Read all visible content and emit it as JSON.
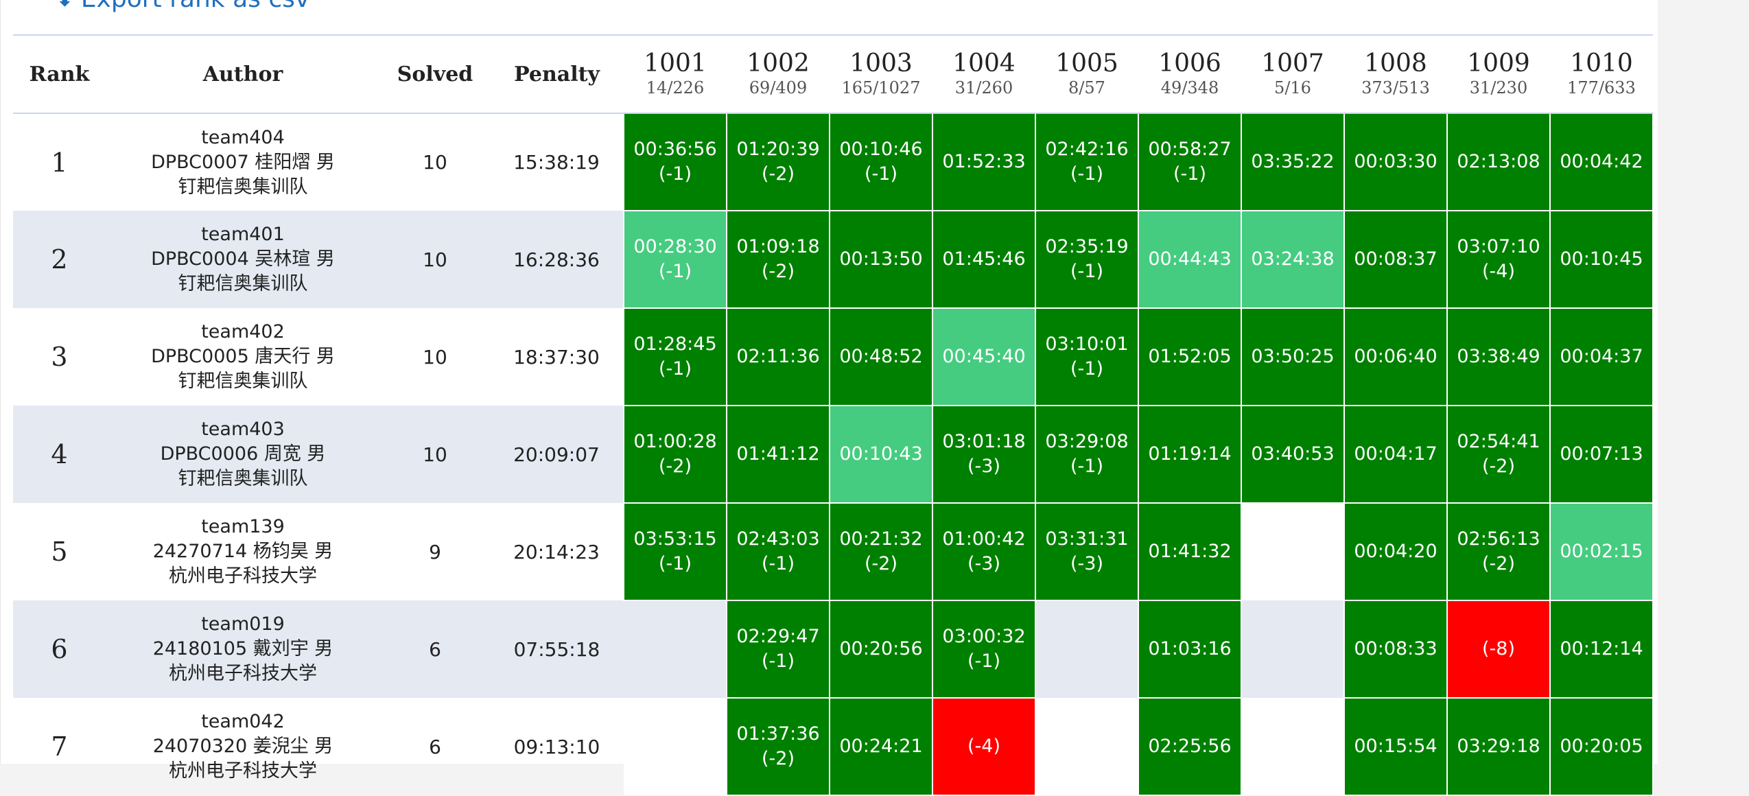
{
  "export": {
    "label": "Export rank as csv",
    "icon": "download-icon"
  },
  "headers": {
    "rank": "Rank",
    "author": "Author",
    "solved": "Solved",
    "penalty": "Penalty"
  },
  "problems": [
    {
      "id": "1001",
      "stat": "14/226"
    },
    {
      "id": "1002",
      "stat": "69/409"
    },
    {
      "id": "1003",
      "stat": "165/1027"
    },
    {
      "id": "1004",
      "stat": "31/260"
    },
    {
      "id": "1005",
      "stat": "8/57"
    },
    {
      "id": "1006",
      "stat": "49/348"
    },
    {
      "id": "1007",
      "stat": "5/16"
    },
    {
      "id": "1008",
      "stat": "373/513"
    },
    {
      "id": "1009",
      "stat": "31/230"
    },
    {
      "id": "1010",
      "stat": "177/633"
    }
  ],
  "colors": {
    "accepted": "#008000",
    "first_blood": "#45cc80",
    "wrong": "#ff0000",
    "alt_row": "#e4e9f2"
  },
  "rows": [
    {
      "rank": "1",
      "team": "team404",
      "member": "DPBC0007 桂阳熠 男",
      "org": "钉耙信奥集训队",
      "solved": "10",
      "penalty": "15:38:19",
      "cells": [
        {
          "s": "ac",
          "time": "00:36:56",
          "tries": "(-1)"
        },
        {
          "s": "ac",
          "time": "01:20:39",
          "tries": "(-2)"
        },
        {
          "s": "ac",
          "time": "00:10:46",
          "tries": "(-1)"
        },
        {
          "s": "ac",
          "time": "01:52:33",
          "tries": ""
        },
        {
          "s": "ac",
          "time": "02:42:16",
          "tries": "(-1)"
        },
        {
          "s": "ac",
          "time": "00:58:27",
          "tries": "(-1)"
        },
        {
          "s": "ac",
          "time": "03:35:22",
          "tries": ""
        },
        {
          "s": "ac",
          "time": "00:03:30",
          "tries": ""
        },
        {
          "s": "ac",
          "time": "02:13:08",
          "tries": ""
        },
        {
          "s": "ac",
          "time": "00:04:42",
          "tries": ""
        }
      ]
    },
    {
      "rank": "2",
      "team": "team401",
      "member": "DPBC0004 吴林瑄 男",
      "org": "钉耙信奥集训队",
      "solved": "10",
      "penalty": "16:28:36",
      "cells": [
        {
          "s": "fb",
          "time": "00:28:30",
          "tries": "(-1)"
        },
        {
          "s": "ac",
          "time": "01:09:18",
          "tries": "(-2)"
        },
        {
          "s": "ac",
          "time": "00:13:50",
          "tries": ""
        },
        {
          "s": "ac",
          "time": "01:45:46",
          "tries": ""
        },
        {
          "s": "ac",
          "time": "02:35:19",
          "tries": "(-1)"
        },
        {
          "s": "fb",
          "time": "00:44:43",
          "tries": ""
        },
        {
          "s": "fb",
          "time": "03:24:38",
          "tries": ""
        },
        {
          "s": "ac",
          "time": "00:08:37",
          "tries": ""
        },
        {
          "s": "ac",
          "time": "03:07:10",
          "tries": "(-4)"
        },
        {
          "s": "ac",
          "time": "00:10:45",
          "tries": ""
        }
      ]
    },
    {
      "rank": "3",
      "team": "team402",
      "member": "DPBC0005 唐天行 男",
      "org": "钉耙信奥集训队",
      "solved": "10",
      "penalty": "18:37:30",
      "cells": [
        {
          "s": "ac",
          "time": "01:28:45",
          "tries": "(-1)"
        },
        {
          "s": "ac",
          "time": "02:11:36",
          "tries": ""
        },
        {
          "s": "ac",
          "time": "00:48:52",
          "tries": ""
        },
        {
          "s": "fb",
          "time": "00:45:40",
          "tries": ""
        },
        {
          "s": "ac",
          "time": "03:10:01",
          "tries": "(-1)"
        },
        {
          "s": "ac",
          "time": "01:52:05",
          "tries": ""
        },
        {
          "s": "ac",
          "time": "03:50:25",
          "tries": ""
        },
        {
          "s": "ac",
          "time": "00:06:40",
          "tries": ""
        },
        {
          "s": "ac",
          "time": "03:38:49",
          "tries": ""
        },
        {
          "s": "ac",
          "time": "00:04:37",
          "tries": ""
        }
      ]
    },
    {
      "rank": "4",
      "team": "team403",
      "member": "DPBC0006 周宽 男",
      "org": "钉耙信奥集训队",
      "solved": "10",
      "penalty": "20:09:07",
      "cells": [
        {
          "s": "ac",
          "time": "01:00:28",
          "tries": "(-2)"
        },
        {
          "s": "ac",
          "time": "01:41:12",
          "tries": ""
        },
        {
          "s": "fb",
          "time": "00:10:43",
          "tries": ""
        },
        {
          "s": "ac",
          "time": "03:01:18",
          "tries": "(-3)"
        },
        {
          "s": "ac",
          "time": "03:29:08",
          "tries": "(-1)"
        },
        {
          "s": "ac",
          "time": "01:19:14",
          "tries": ""
        },
        {
          "s": "ac",
          "time": "03:40:53",
          "tries": ""
        },
        {
          "s": "ac",
          "time": "00:04:17",
          "tries": ""
        },
        {
          "s": "ac",
          "time": "02:54:41",
          "tries": "(-2)"
        },
        {
          "s": "ac",
          "time": "00:07:13",
          "tries": ""
        }
      ]
    },
    {
      "rank": "5",
      "team": "team139",
      "member": "24270714 杨钧昊 男",
      "org": "杭州电子科技大学",
      "solved": "9",
      "penalty": "20:14:23",
      "cells": [
        {
          "s": "ac",
          "time": "03:53:15",
          "tries": "(-1)"
        },
        {
          "s": "ac",
          "time": "02:43:03",
          "tries": "(-1)"
        },
        {
          "s": "ac",
          "time": "00:21:32",
          "tries": "(-2)"
        },
        {
          "s": "ac",
          "time": "01:00:42",
          "tries": "(-3)"
        },
        {
          "s": "ac",
          "time": "03:31:31",
          "tries": "(-3)"
        },
        {
          "s": "ac",
          "time": "01:41:32",
          "tries": ""
        },
        {
          "s": "empty",
          "time": "",
          "tries": ""
        },
        {
          "s": "ac",
          "time": "00:04:20",
          "tries": ""
        },
        {
          "s": "ac",
          "time": "02:56:13",
          "tries": "(-2)"
        },
        {
          "s": "fb",
          "time": "00:02:15",
          "tries": ""
        }
      ]
    },
    {
      "rank": "6",
      "team": "team019",
      "member": "24180105 戴刘宇 男",
      "org": "杭州电子科技大学",
      "solved": "6",
      "penalty": "07:55:18",
      "cells": [
        {
          "s": "empty",
          "time": "",
          "tries": ""
        },
        {
          "s": "ac",
          "time": "02:29:47",
          "tries": "(-1)"
        },
        {
          "s": "ac",
          "time": "00:20:56",
          "tries": ""
        },
        {
          "s": "ac",
          "time": "03:00:32",
          "tries": "(-1)"
        },
        {
          "s": "empty",
          "time": "",
          "tries": ""
        },
        {
          "s": "ac",
          "time": "01:03:16",
          "tries": ""
        },
        {
          "s": "empty",
          "time": "",
          "tries": ""
        },
        {
          "s": "ac",
          "time": "00:08:33",
          "tries": ""
        },
        {
          "s": "wa",
          "time": "(-8)",
          "tries": ""
        },
        {
          "s": "ac",
          "time": "00:12:14",
          "tries": ""
        }
      ]
    },
    {
      "rank": "7",
      "team": "team042",
      "member": "24070320 姜淣尘 男",
      "org": "杭州电子科技大学",
      "solved": "6",
      "penalty": "09:13:10",
      "cells": [
        {
          "s": "empty",
          "time": "",
          "tries": ""
        },
        {
          "s": "ac",
          "time": "01:37:36",
          "tries": "(-2)"
        },
        {
          "s": "ac",
          "time": "00:24:21",
          "tries": ""
        },
        {
          "s": "wa",
          "time": "(-4)",
          "tries": ""
        },
        {
          "s": "empty",
          "time": "",
          "tries": ""
        },
        {
          "s": "ac",
          "time": "02:25:56",
          "tries": ""
        },
        {
          "s": "empty",
          "time": "",
          "tries": ""
        },
        {
          "s": "ac",
          "time": "00:15:54",
          "tries": ""
        },
        {
          "s": "ac",
          "time": "03:29:18",
          "tries": ""
        },
        {
          "s": "ac",
          "time": "00:20:05",
          "tries": ""
        }
      ]
    }
  ]
}
